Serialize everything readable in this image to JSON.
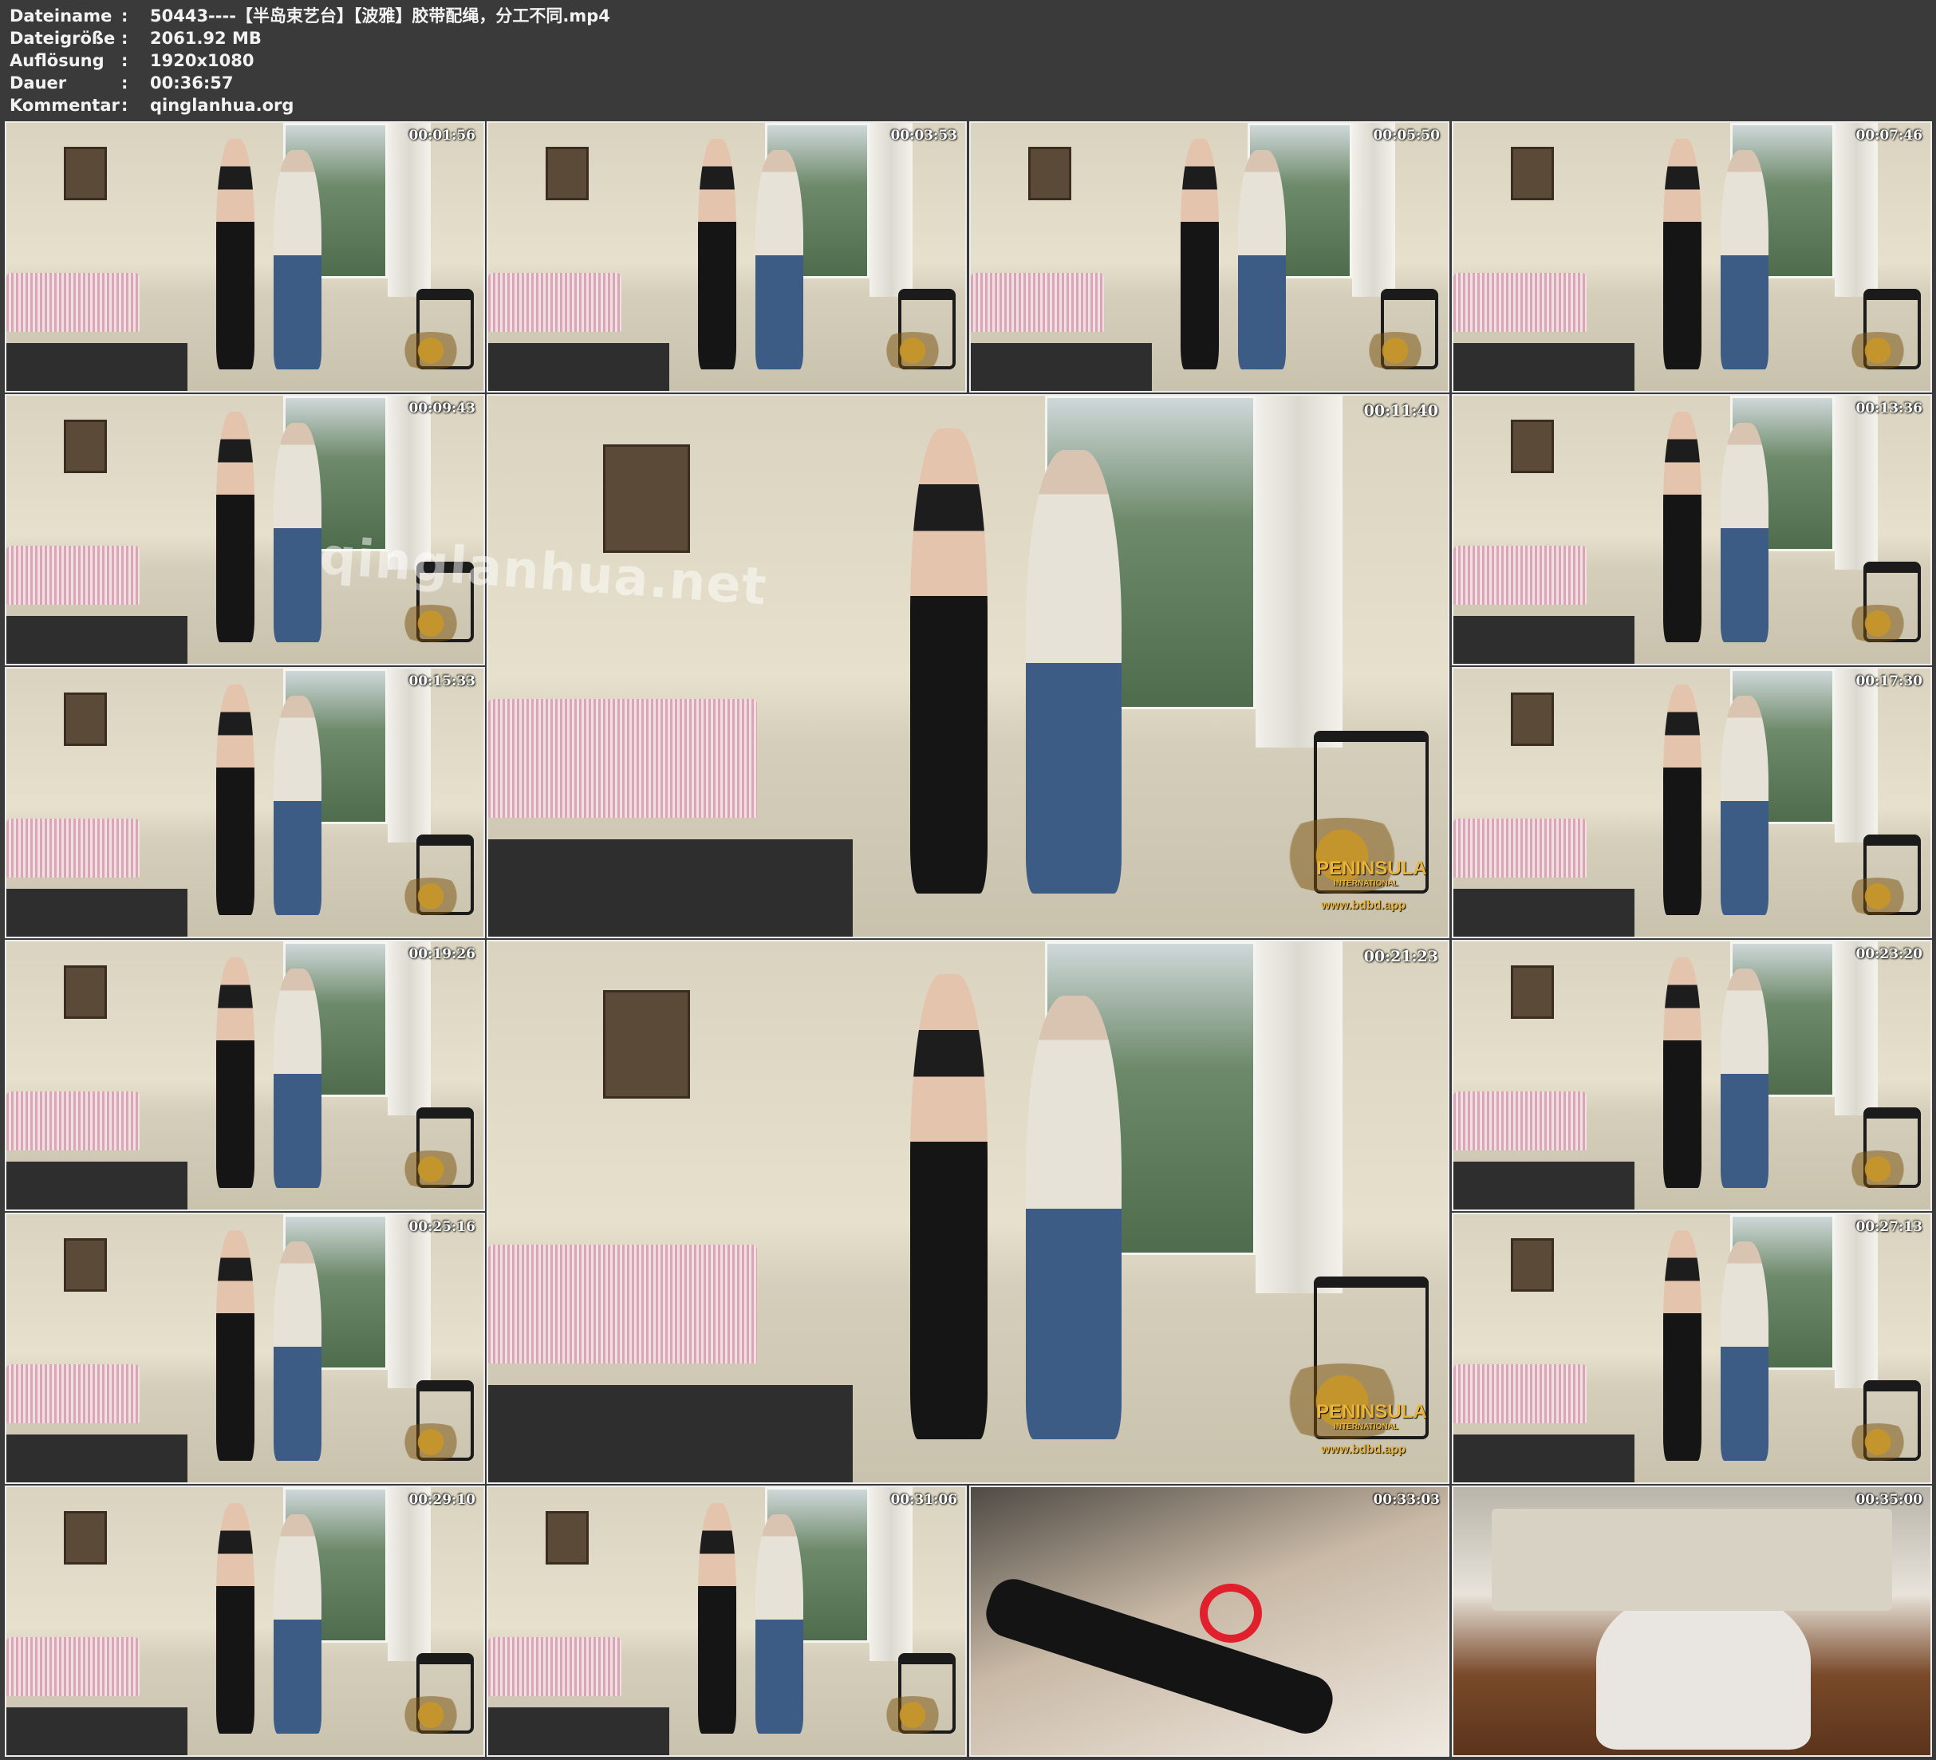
{
  "meta": [
    {
      "label": "Dateiname",
      "sep": ":",
      "value": "50443----【半岛束艺台】【波雅】胶带配绳，分工不同.mp4"
    },
    {
      "label": "Dateigröße",
      "sep": ":",
      "value": "2061.92 MB"
    },
    {
      "label": "Auflösung",
      "sep": ":",
      "value": "1920x1080"
    },
    {
      "label": "Dauer",
      "sep": ":",
      "value": "00:36:57"
    },
    {
      "label": "Kommentar",
      "sep": ":",
      "value": "qinglanhua.org"
    }
  ],
  "thumbnails": [
    {
      "time": "00:01:56",
      "scene": "room"
    },
    {
      "time": "00:03:53",
      "scene": "room"
    },
    {
      "time": "00:05:50",
      "scene": "room"
    },
    {
      "time": "00:07:46",
      "scene": "room"
    },
    {
      "time": "00:09:43",
      "scene": "room"
    },
    {
      "time": "00:11:40",
      "scene": "room"
    },
    {
      "time": "00:13:36",
      "scene": "room"
    },
    {
      "time": "00:15:33",
      "scene": "room"
    },
    {
      "time": "00:17:30",
      "scene": "room"
    },
    {
      "time": "00:19:26",
      "scene": "room"
    },
    {
      "time": "00:21:23",
      "scene": "room"
    },
    {
      "time": "00:23:20",
      "scene": "room"
    },
    {
      "time": "00:25:16",
      "scene": "room"
    },
    {
      "time": "00:27:13",
      "scene": "room"
    },
    {
      "time": "00:29:10",
      "scene": "room"
    },
    {
      "time": "00:31:06",
      "scene": "room"
    },
    {
      "time": "00:33:03",
      "scene": "closeup"
    },
    {
      "time": "00:35:00",
      "scene": "floor"
    }
  ],
  "overlay": {
    "watermark": "qinglanhua.net",
    "logo_brand": "PENINSULA",
    "logo_sub": "INTERNATIONAL",
    "logo_url": "www.bdbd.app"
  }
}
